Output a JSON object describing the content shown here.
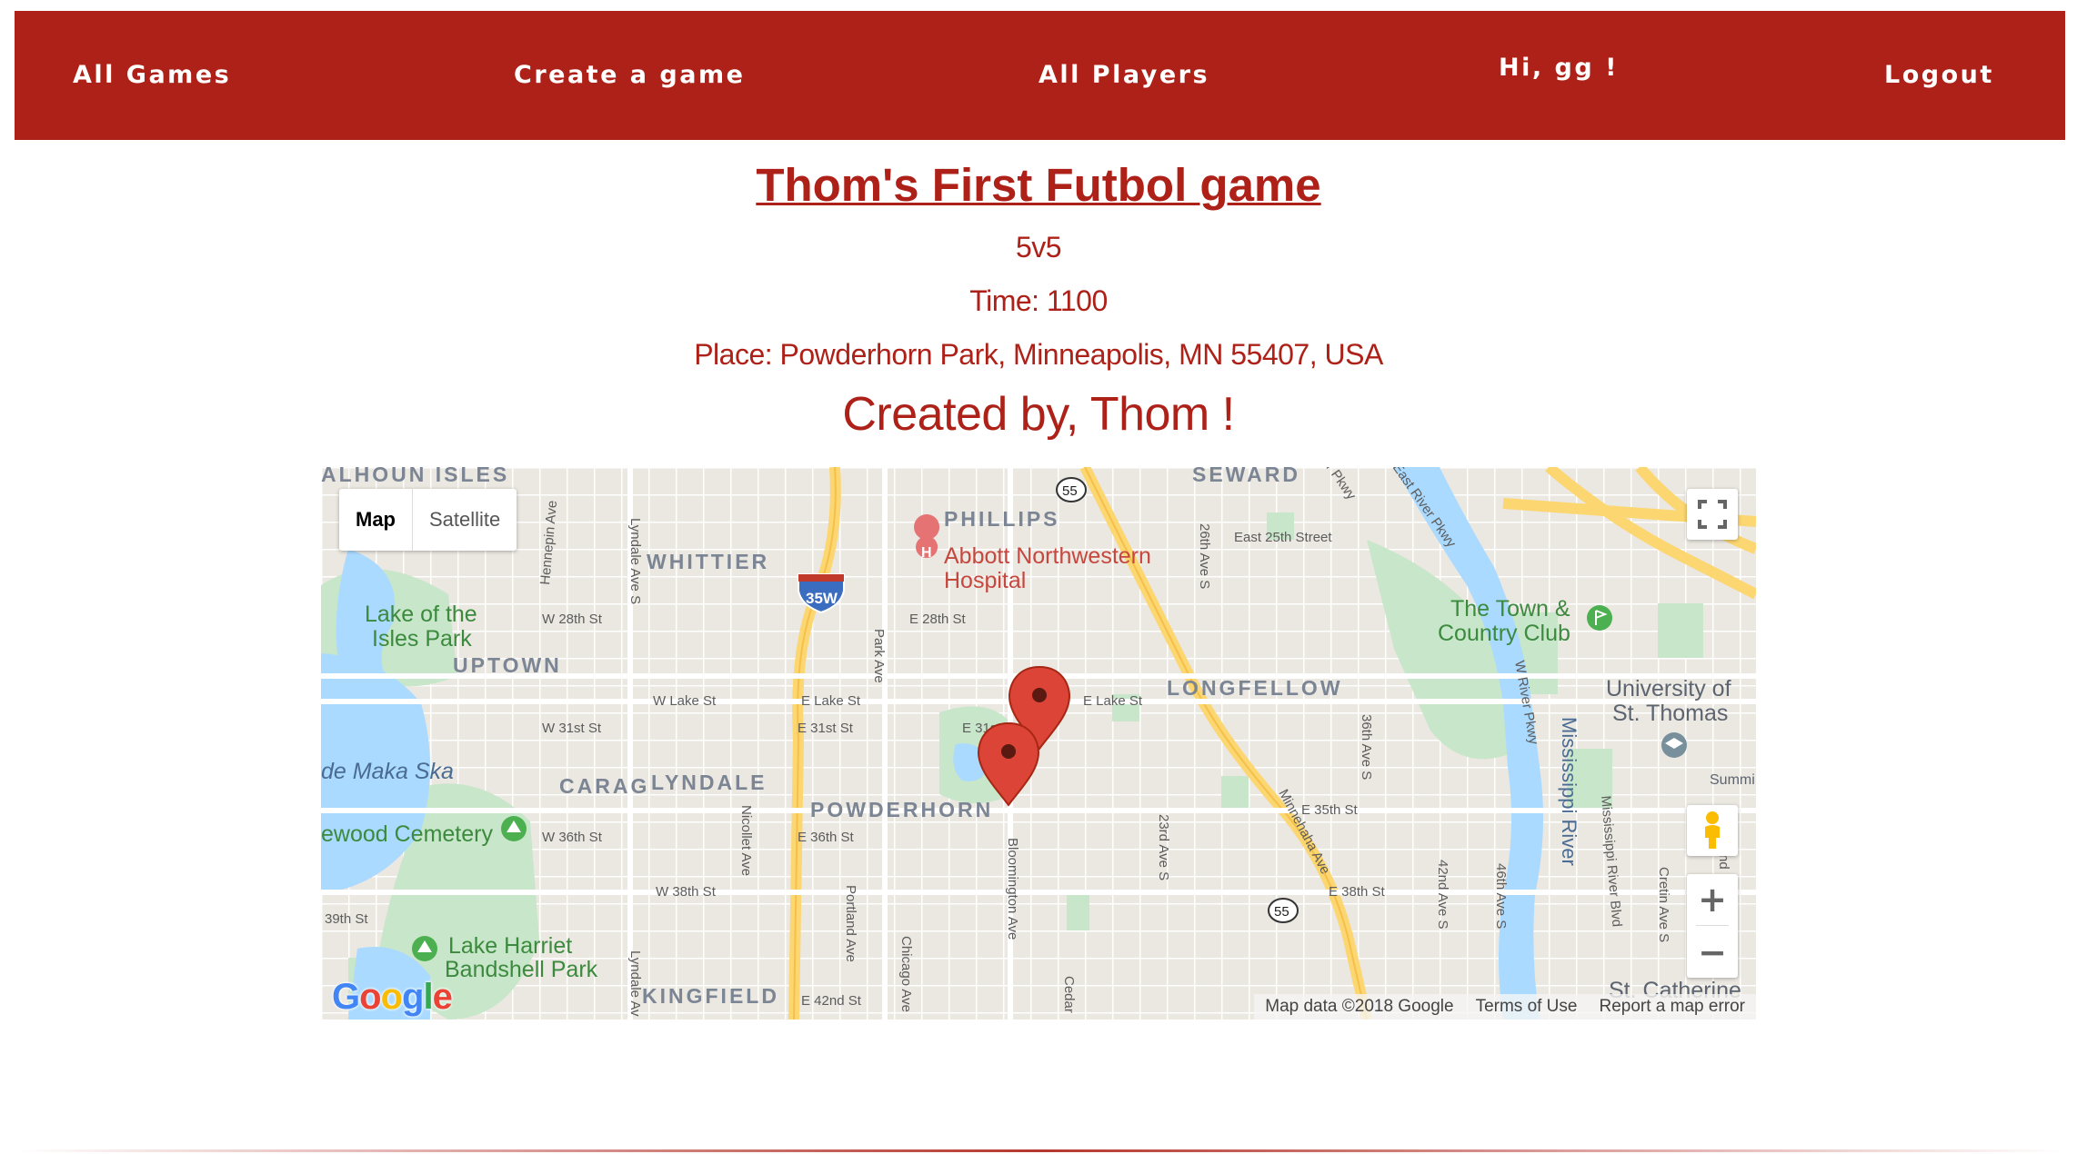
{
  "nav": {
    "all_games": "All Games",
    "create_game": "Create a game",
    "all_players": "All Players",
    "greeting": "Hi, gg !",
    "logout": "Logout"
  },
  "game": {
    "title": "Thom's First Futbol game",
    "format": "5v5",
    "time": "Time: 1100",
    "place": "Place: Powderhorn Park, Minneapolis, MN 55407, USA",
    "creator": "Created by, Thom !"
  },
  "map": {
    "type_map": "Map",
    "type_satellite": "Satellite",
    "zoom_in": "+",
    "zoom_out": "−",
    "attribution": "Map data ©2018 Google",
    "terms": "Terms of Use",
    "report": "Report a map error",
    "neighborhoods": {
      "calhoun_isles": "ALHOUN ISLES",
      "phillips": "PHILLIPS",
      "seward": "SEWARD",
      "whittier": "WHITTIER",
      "uptown": "UPTOWN",
      "longfellow": "LONGFELLOW",
      "carag": "CARAG",
      "lyndale": "LYNDALE",
      "powderhorn": "POWDERHORN",
      "kingfield": "KINGFIELD"
    },
    "places": {
      "abbott_1": "Abbott Northwestern",
      "abbott_2": "Hospital",
      "lake_isles_1": "Lake of the",
      "lake_isles_2": "Isles Park",
      "town_country_1": "The Town &",
      "town_country_2": "Country Club",
      "ust_1": "University of",
      "ust_2": "St. Thomas",
      "bde_maka": "de Maka Ska",
      "cemetery": "ewood Cemetery",
      "harriet_1": "Lake Harriet",
      "harriet_2": "Bandshell Park",
      "st_catherine": "St. Catherine",
      "mississippi": "Mississippi River",
      "summit": "Summi"
    },
    "streets": {
      "w28": "W 28th St",
      "e28": "E 28th St",
      "wlake": "W Lake St",
      "elake1": "E Lake St",
      "elake2": "E Lake St",
      "w31": "W 31st St",
      "e31a": "E 31st St",
      "e31b": "E 31st St",
      "e25": "East 25th Street",
      "e35": "E 35th St",
      "w36": "W 36th St",
      "e36": "E 36th St",
      "w38": "W 38th St",
      "e38": "E 38th St",
      "s39": "39th St",
      "e42": "E 42nd St",
      "hennepin": "Hennepin Ave",
      "lyndale_n": "Lyndale Ave S",
      "lyndale_s": "Lyndale Av",
      "park": "Park Ave",
      "nicollet": "Nicollet Ave",
      "portland": "Portland Ave",
      "chicago": "Chicago Ave",
      "bloomington": "Bloomington Ave",
      "cedar": "Cedar",
      "s23": "23rd Ave S",
      "s26": "26th Ave S",
      "s36": "36th Ave S",
      "s42": "42nd Ave S",
      "s46": "46th Ave S",
      "minnehaha": "Minnehaha Ave",
      "wriver": "W River Pkwy",
      "eriver": "East River Pkwy",
      "mriver": "Mississippi River Blvd",
      "cretin": "Cretin Ave S",
      "pkwy": "r Pkwy",
      "ind": "nd"
    },
    "shields": {
      "i35w": "35W",
      "mn55_top": "55",
      "mn55_bottom": "55"
    },
    "colors": {
      "land": "#ebe7e1",
      "water": "#aadaff",
      "park": "#c8e6c9",
      "highway": "#fcd670",
      "marker": "#db4437"
    }
  }
}
